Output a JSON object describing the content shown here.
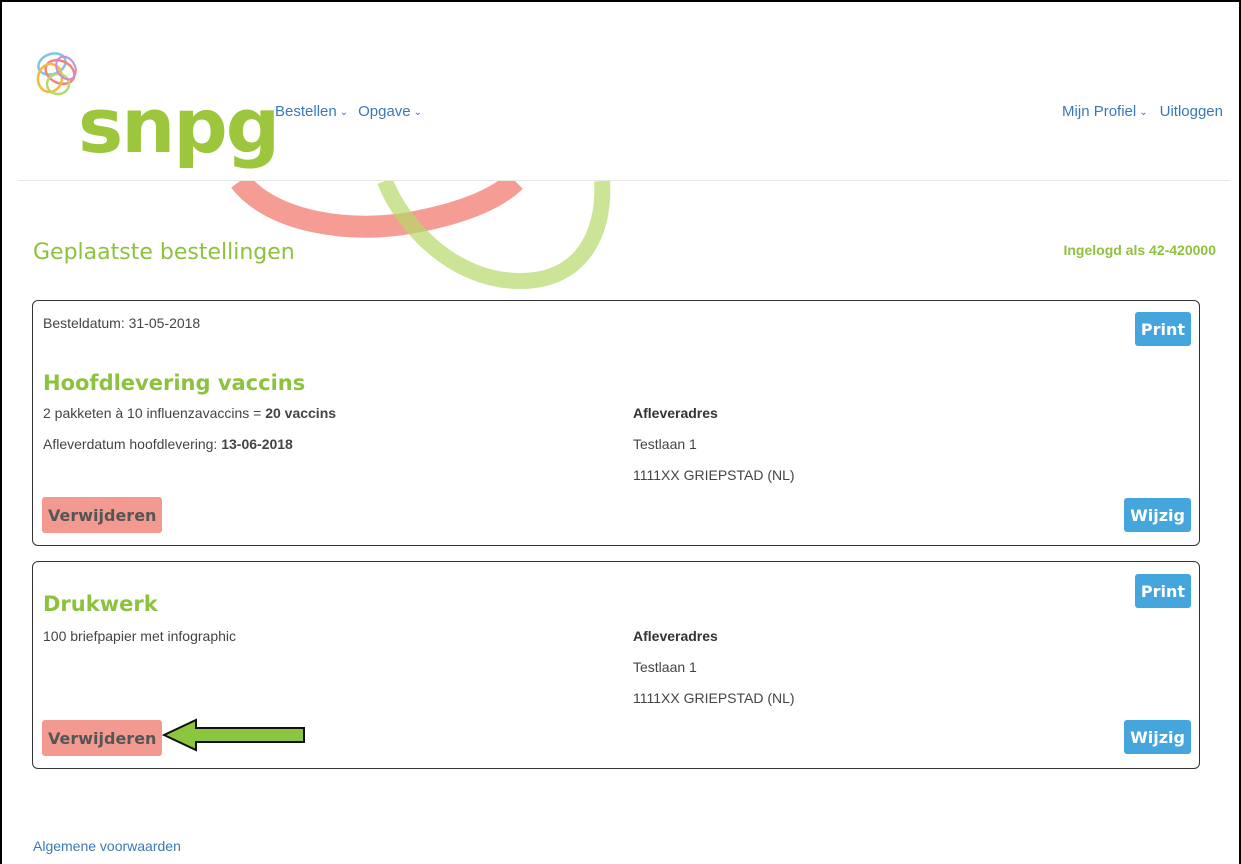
{
  "brand": {
    "name": "snpg",
    "color": "#9cc63b"
  },
  "nav": {
    "left": [
      {
        "label": "Bestellen",
        "icon": "chevron-down-icon"
      },
      {
        "label": "Opgave",
        "icon": "chevron-down-icon"
      }
    ],
    "right": [
      {
        "label": "Mijn Profiel",
        "icon": "chevron-down-icon"
      },
      {
        "label": "Uitloggen"
      }
    ]
  },
  "page": {
    "title": "Geplaatste bestellingen",
    "logged_in": "Ingelogd als 42-420000"
  },
  "orders": [
    {
      "order_date": "Besteldatum: 31-05-2018",
      "title": "Hoofdlevering vaccins",
      "description_prefix": "2 pakketen à 10 influenzavaccins = ",
      "description_bold": "20 vaccins",
      "delivery_prefix": "Afleverdatum hoofdlevering: ",
      "delivery_date": "13-06-2018",
      "address_heading": "Afleveradres",
      "address_line1": "Testlaan 1",
      "address_line2": "1111XX GRIEPSTAD (NL)",
      "print_label": "Print",
      "edit_label": "Wijzig",
      "delete_label": "Verwijderen"
    },
    {
      "title": "Drukwerk",
      "description": "100 briefpapier met infographic",
      "address_heading": "Afleveradres",
      "address_line1": "Testlaan 1",
      "address_line2": "1111XX GRIEPSTAD (NL)",
      "print_label": "Print",
      "edit_label": "Wijzig",
      "delete_label": "Verwijderen"
    }
  ],
  "footer": {
    "terms_link": "Algemene voorwaarden"
  },
  "colors": {
    "accent_green": "#8cc23e",
    "button_blue": "#44a6dc",
    "button_red": "#f29a8f",
    "link_blue": "#3b78b8"
  }
}
